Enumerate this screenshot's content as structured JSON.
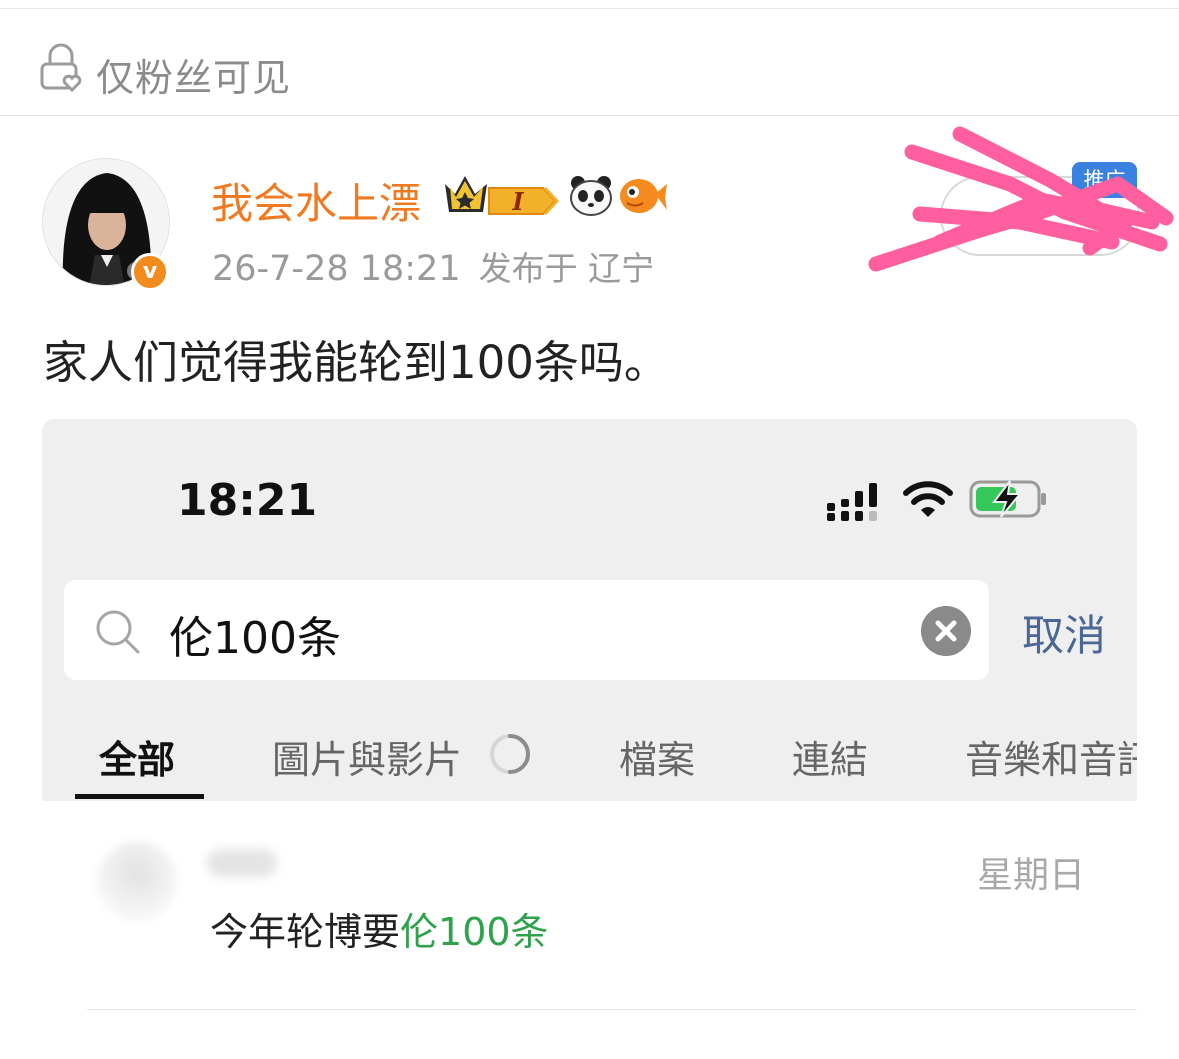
{
  "visibility": {
    "label": "仅粉丝可见",
    "icon": "lock-heart-icon"
  },
  "post": {
    "author": "我会水上漂",
    "badges": [
      "crown-level-badge",
      "panda-icon",
      "fish-icon"
    ],
    "badge_level": "I",
    "verified_mark": "v",
    "timestamp": "26-7-28 18:21",
    "location": "发布于 辽宁",
    "ad_tag": "推广",
    "text": "家人们觉得我能轮到100条吗。"
  },
  "screenshot": {
    "status_bar": {
      "time": "18:21"
    },
    "search": {
      "query": "伦100条",
      "cancel_label": "取消"
    },
    "tabs": [
      {
        "label": "全部",
        "active": true
      },
      {
        "label": "圖片與影片",
        "active": false
      },
      {
        "label": "檔案",
        "active": false
      },
      {
        "label": "連結",
        "active": false
      },
      {
        "label": "音樂和音訊",
        "active": false
      }
    ],
    "result": {
      "date": "星期日",
      "snippet_prefix": "今年轮博要",
      "snippet_highlight": "伦100条"
    }
  },
  "colors": {
    "username": "#ef7a22",
    "highlight": "#2fa24c",
    "cancel": "#4a6796",
    "ad_tag": "#3b82e0",
    "scribble": "#ff5f9e"
  }
}
